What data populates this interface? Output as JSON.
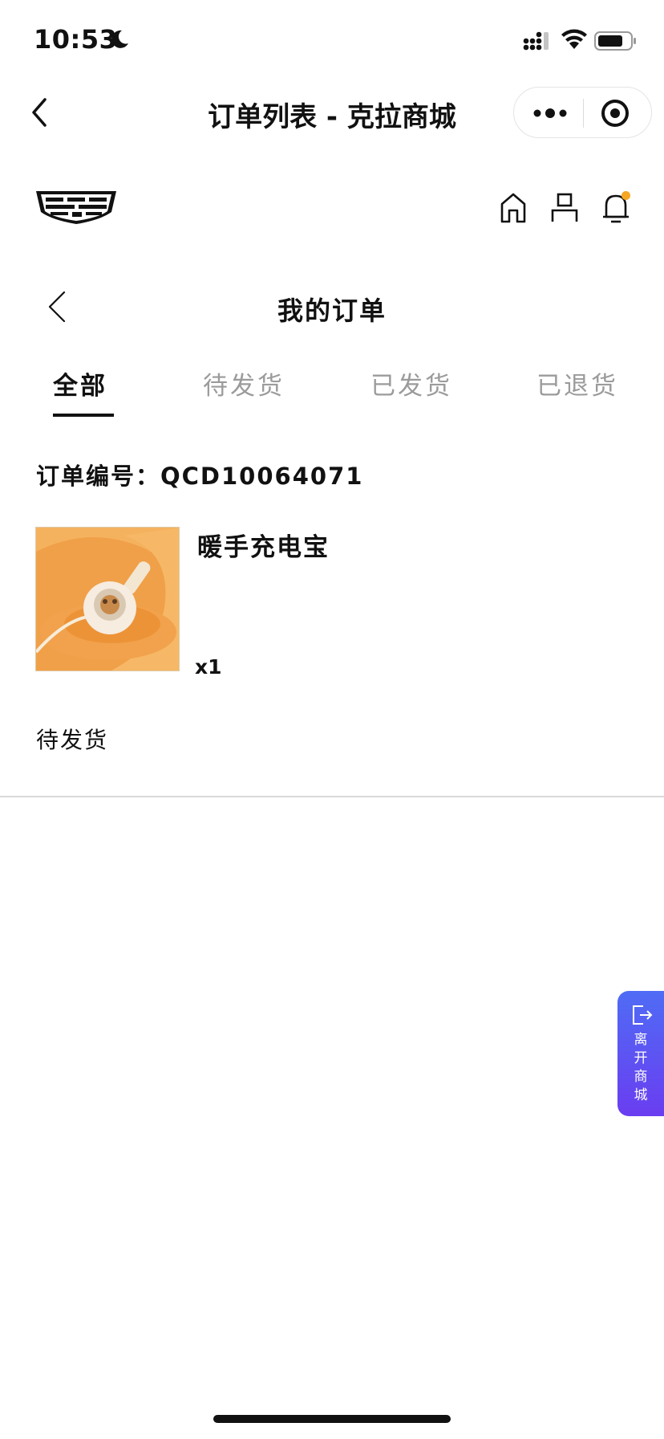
{
  "status_bar": {
    "time": "10:53"
  },
  "nav": {
    "title": "订单列表 - 克拉商城"
  },
  "page": {
    "title": "我的订单"
  },
  "tabs": [
    {
      "label": "全部",
      "active": true
    },
    {
      "label": "待发货",
      "active": false
    },
    {
      "label": "已发货",
      "active": false
    },
    {
      "label": "已退货",
      "active": false
    }
  ],
  "order": {
    "number_text": "订单编号：QCD10064071",
    "product_name": "暖手充电宝",
    "quantity": "x1",
    "status": "待发货"
  },
  "floating": {
    "leave_label": "离\n开\n商\n城"
  },
  "icons": {
    "status": [
      "moon-icon",
      "signal-icon",
      "wifi-icon",
      "battery-icon"
    ],
    "nav": [
      "back-icon",
      "more-icon",
      "target-icon"
    ],
    "header": [
      "logo",
      "home-icon",
      "user-icon",
      "bell-icon"
    ],
    "floating": "exit-icon"
  },
  "colors": {
    "text": "#111111",
    "tab_inactive": "#9b9b9b",
    "notification_dot": "#f5a623",
    "leave_gradient_start": "#4f6cf5",
    "leave_gradient_end": "#6a3df0",
    "product_bg": "#f0a048"
  }
}
